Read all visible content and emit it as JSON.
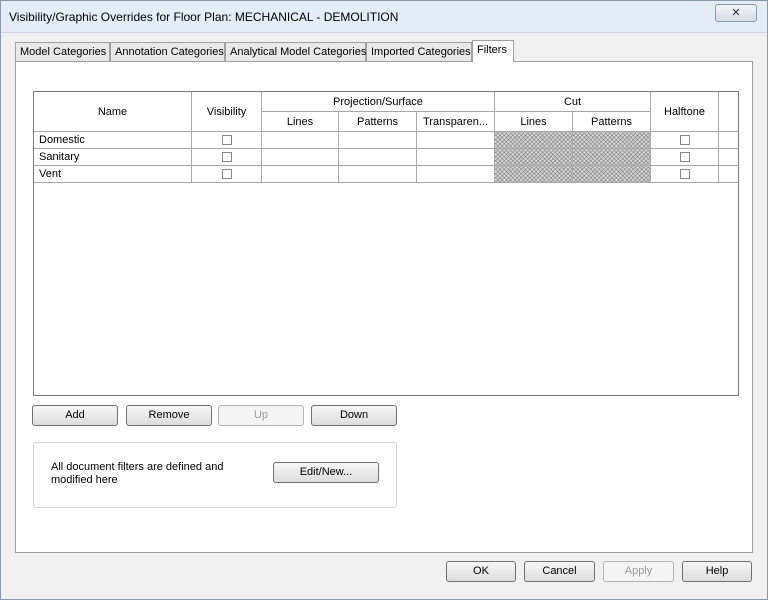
{
  "window": {
    "title": "Visibility/Graphic Overrides for Floor Plan: MECHANICAL - DEMOLITION",
    "close_glyph": "✕"
  },
  "tabs": [
    {
      "label": "Model Categories"
    },
    {
      "label": "Annotation Categories"
    },
    {
      "label": "Analytical Model Categories"
    },
    {
      "label": "Imported Categories"
    },
    {
      "label": "Filters",
      "active": true
    }
  ],
  "grid": {
    "headers": {
      "name": "Name",
      "visibility": "Visibility",
      "projection_surface": "Projection/Surface",
      "cut": "Cut",
      "halftone": "Halftone",
      "proj_lines": "Lines",
      "proj_patterns": "Patterns",
      "proj_transparency": "Transparen...",
      "cut_lines": "Lines",
      "cut_patterns": "Patterns"
    },
    "rows": [
      {
        "name": "Domestic",
        "visible": false,
        "halftone": false
      },
      {
        "name": "Sanitary",
        "visible": false,
        "halftone": false
      },
      {
        "name": "Vent",
        "visible": false,
        "halftone": false
      }
    ]
  },
  "buttons": {
    "add": "Add",
    "remove": "Remove",
    "up": "Up",
    "down": "Down",
    "edit_new": "Edit/New...",
    "ok": "OK",
    "cancel": "Cancel",
    "apply": "Apply",
    "help": "Help"
  },
  "filter_info": "All document filters are defined and modified here"
}
